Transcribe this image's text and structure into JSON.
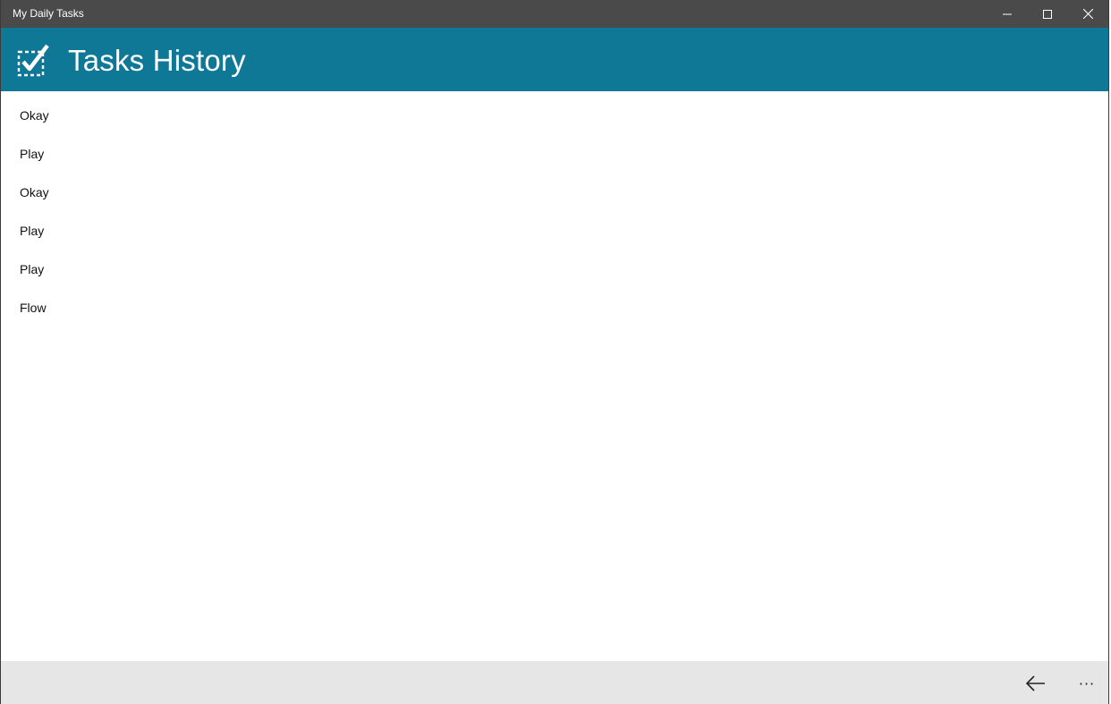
{
  "window": {
    "title": "My Daily Tasks"
  },
  "header": {
    "title": "Tasks History",
    "accent_color": "#0f7896",
    "logo_icon": "checkbox-checked-icon"
  },
  "tasks": [
    {
      "label": "Okay"
    },
    {
      "label": "Play"
    },
    {
      "label": "Okay"
    },
    {
      "label": "Play"
    },
    {
      "label": "Play"
    },
    {
      "label": "Flow"
    }
  ],
  "appbar": {
    "back_icon": "arrow-left-icon",
    "more_label": "···"
  }
}
